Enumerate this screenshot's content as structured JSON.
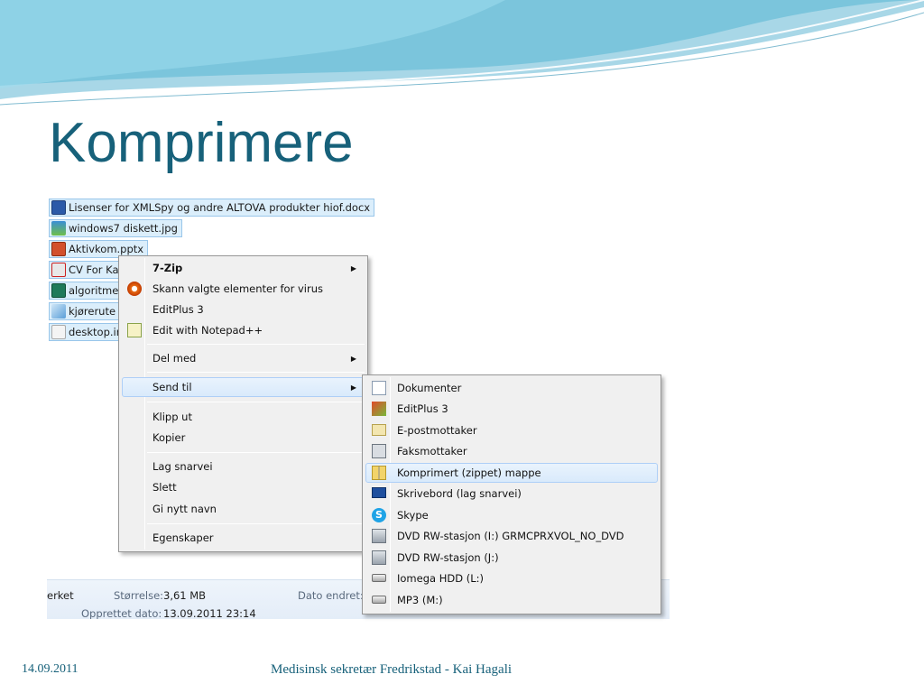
{
  "slide": {
    "title": "Komprimere",
    "footer_date": "14.09.2011",
    "footer_text": "Medisinsk sekretær Fredrikstad - Kai Hagali"
  },
  "colors": {
    "title": "#17617a",
    "wave": "#4aa9cc",
    "highlight": "#d9eafb"
  },
  "files": [
    {
      "label": "Lisenser for XMLSpy og andre ALTOVA produkter hiof.docx",
      "icon": "word-doc-icon"
    },
    {
      "label": "windows7 diskett.jpg",
      "icon": "image-file-icon"
    },
    {
      "label": "Aktivkom.pptx",
      "icon": "powerpoint-file-icon"
    },
    {
      "label": "CV For Ka",
      "icon": "pdf-file-icon"
    },
    {
      "label": "algoritme",
      "icon": "publisher-file-icon"
    },
    {
      "label": "kjørerute l",
      "icon": "map-file-icon"
    },
    {
      "label": "desktop.in",
      "icon": "ini-file-icon"
    }
  ],
  "statusbar": {
    "name_partial": "erket",
    "size_label": "Størrelse:",
    "size_value": "3,61 MB",
    "modified_label": "Dato endret:",
    "created_label": "Opprettet dato:",
    "created_value": "13.09.2011 23:14"
  },
  "context_menu": {
    "items": [
      {
        "label": "7-Zip",
        "submenu": true,
        "bold": true
      },
      {
        "label": "Skann valgte elementer for virus",
        "icon": "antivirus-icon"
      },
      {
        "label": "EditPlus 3"
      },
      {
        "label": "Edit with Notepad++",
        "icon": "notepad-plus-plus-icon"
      },
      {
        "label": "Del med",
        "submenu": true
      },
      {
        "label": "Send til",
        "submenu": true,
        "highlighted": true
      },
      {
        "label": "Klipp ut"
      },
      {
        "label": "Kopier"
      },
      {
        "label": "Lag snarvei"
      },
      {
        "label": "Slett"
      },
      {
        "label": "Gi nytt navn"
      },
      {
        "label": "Egenskaper"
      }
    ]
  },
  "send_to_menu": {
    "items": [
      {
        "label": "Dokumenter",
        "icon": "documents-icon"
      },
      {
        "label": "EditPlus 3",
        "icon": "editplus-icon"
      },
      {
        "label": "E-postmottaker",
        "icon": "mail-recipient-icon"
      },
      {
        "label": "Faksmottaker",
        "icon": "fax-icon"
      },
      {
        "label": "Komprimert (zippet) mappe",
        "icon": "zip-folder-icon",
        "highlighted": true
      },
      {
        "label": "Skrivebord (lag snarvei)",
        "icon": "desktop-icon"
      },
      {
        "label": "Skype",
        "icon": "skype-icon"
      },
      {
        "label": "DVD RW-stasjon (I:) GRMCPRXVOL_NO_DVD",
        "icon": "dvd-drive-icon"
      },
      {
        "label": "DVD RW-stasjon (J:)",
        "icon": "dvd-drive-icon"
      },
      {
        "label": "Iomega HDD (L:)",
        "icon": "hard-drive-icon"
      },
      {
        "label": "MP3 (M:)",
        "icon": "removable-drive-icon"
      }
    ]
  }
}
